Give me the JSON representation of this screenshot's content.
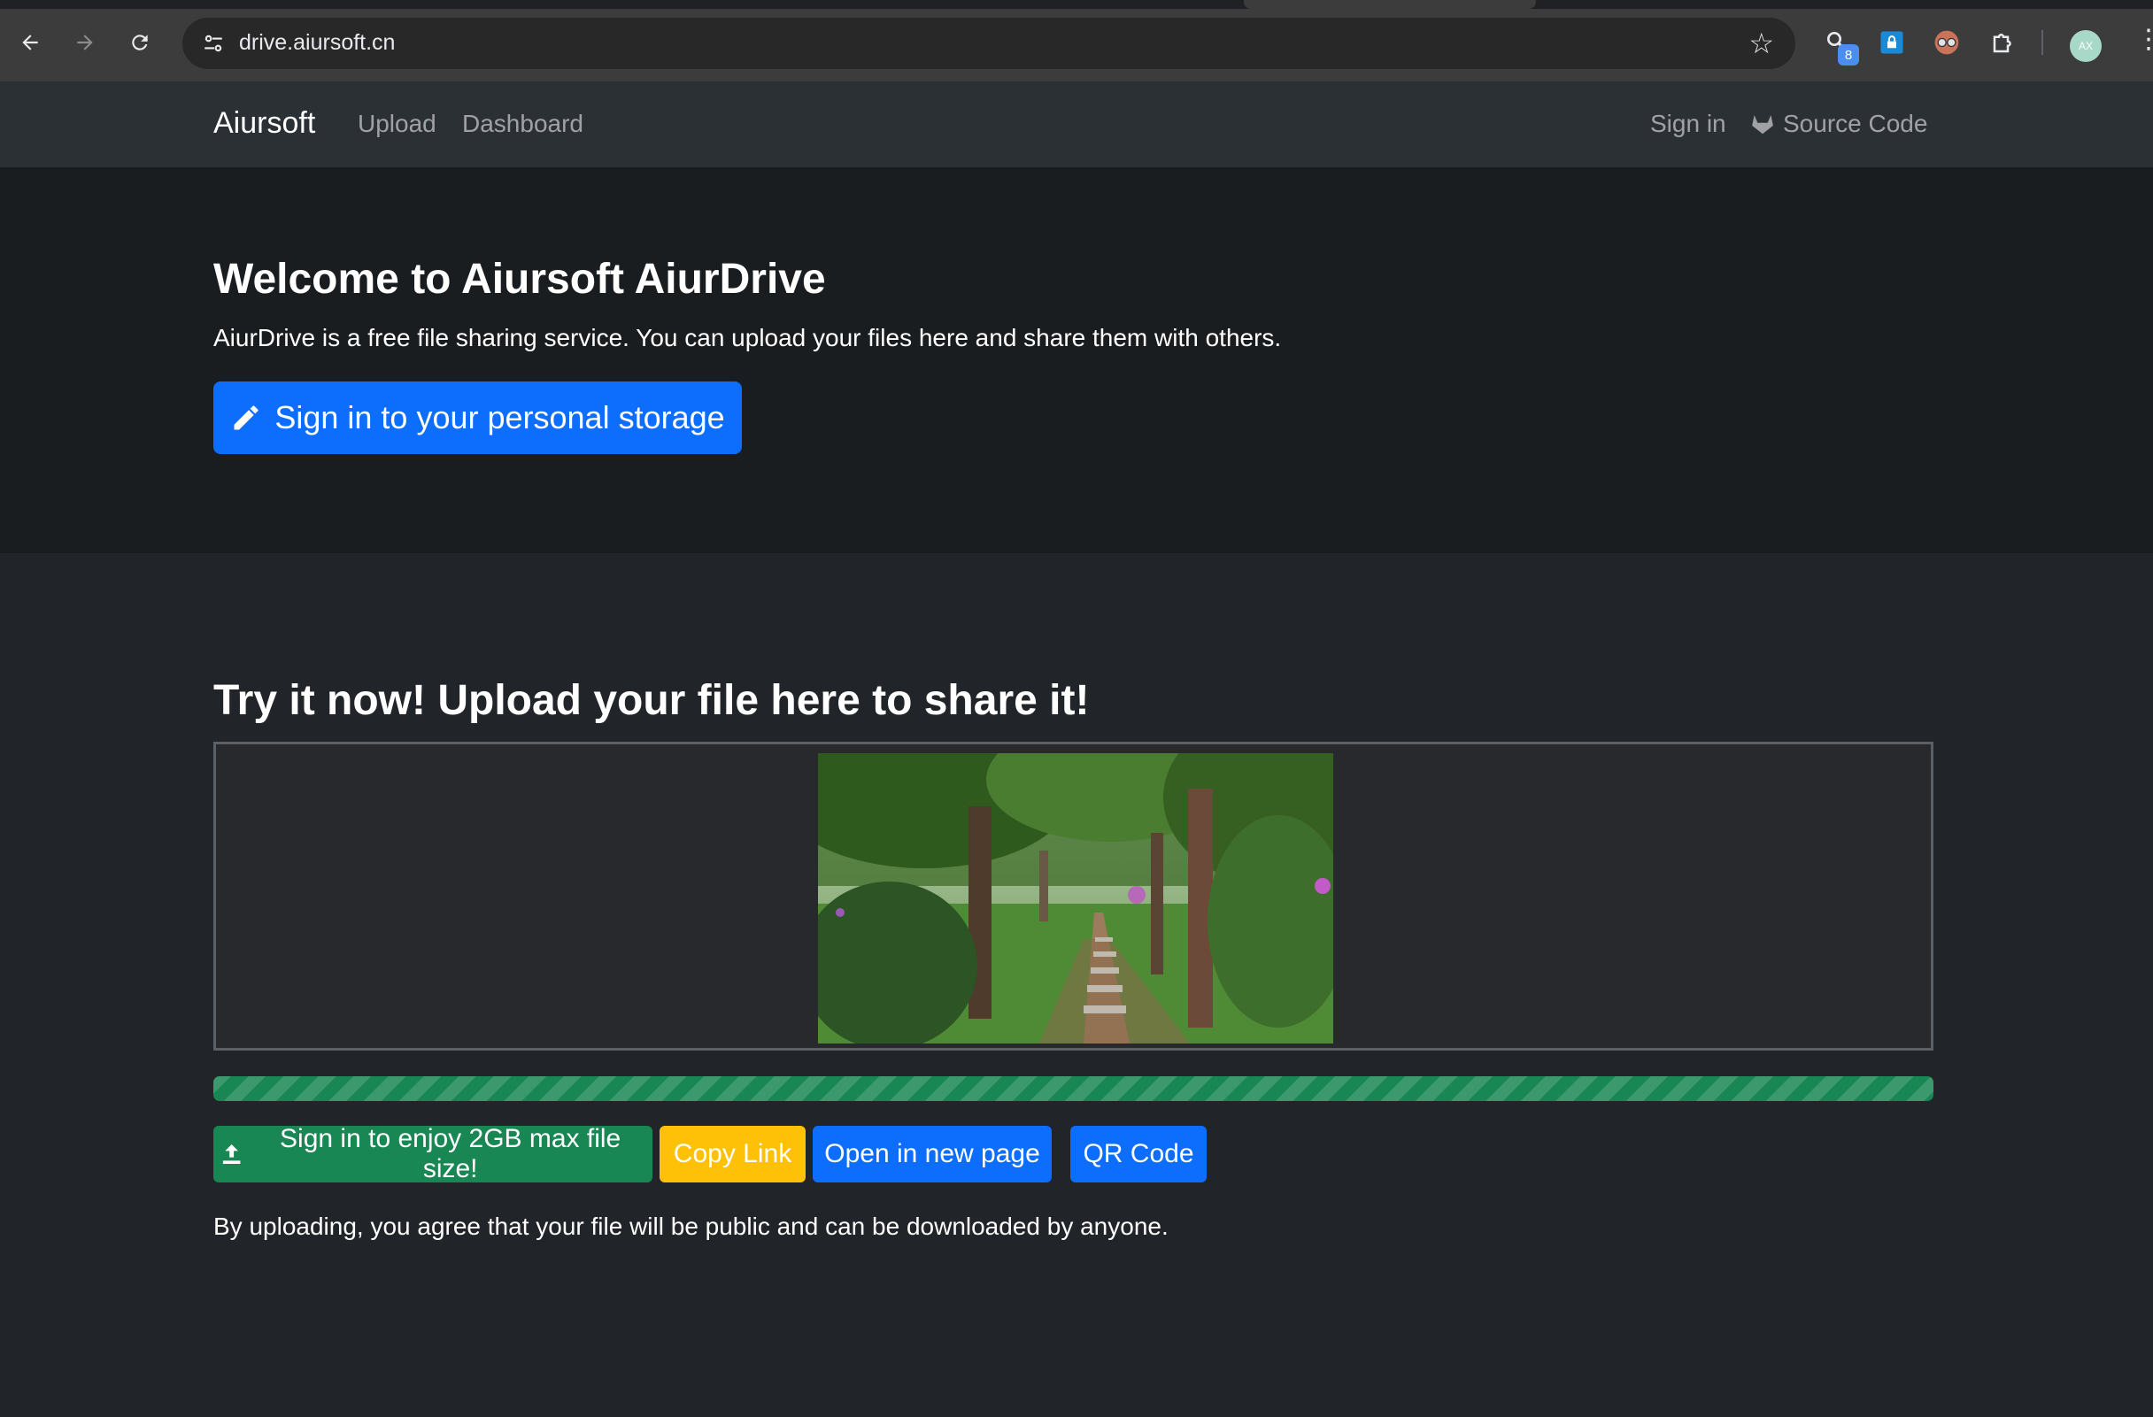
{
  "browser": {
    "url": "drive.aiursoft.cn",
    "icons": {
      "back": "arrow-left-icon",
      "forward": "arrow-right-icon",
      "reload": "reload-icon",
      "site_info": "tune-icon",
      "bookmark": "star-icon",
      "extensions": "puzzle-icon",
      "menu": "more-vertical-icon"
    },
    "extension_badge": "8",
    "profile_initials": "AX"
  },
  "navbar": {
    "brand": "Aiursoft",
    "links": [
      "Upload",
      "Dashboard"
    ],
    "sign_in": "Sign in",
    "source_code": "Source Code",
    "source_icon": "gitlab-icon"
  },
  "hero": {
    "title": "Welcome to Aiursoft AiurDrive",
    "description": "AiurDrive is a free file sharing service. You can upload your files here and share them with others.",
    "cta_label": "Sign in to your personal storage",
    "cta_icon": "pencil-icon"
  },
  "upload": {
    "title": "Try it now! Upload your file here to share it!",
    "preview_alt": "park pathway photo",
    "progress": 1.0,
    "buttons": {
      "signin_label": "Sign in to enjoy 2GB max file size!",
      "signin_icon": "upload-icon",
      "copy_link": "Copy Link",
      "open_new_page": "Open in new page",
      "qr_code": "QR Code"
    },
    "disclaimer": "By uploading, you agree that your file will be public and can be downloaded by anyone."
  },
  "colors": {
    "primary": "#0d6efd",
    "success": "#198754",
    "warning": "#ffc107",
    "background": "#212529"
  }
}
